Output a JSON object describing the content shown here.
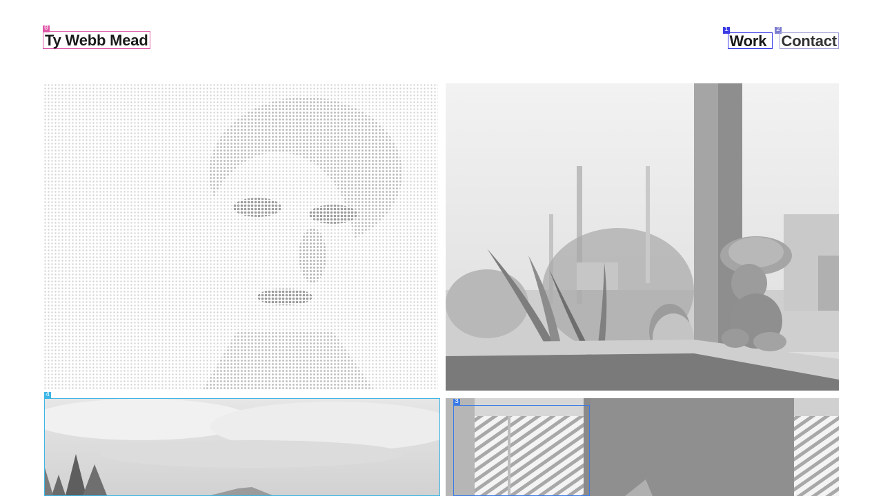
{
  "header": {
    "site_title": "Ty Webb Mead",
    "nav": [
      {
        "label": "Work"
      },
      {
        "label": "Contact"
      }
    ]
  },
  "annotations": {
    "title_index": "0",
    "work_index": "1",
    "contact_index": "2",
    "inner_index": "3",
    "tile_index": "4"
  },
  "colors": {
    "title_box": "#e056a7",
    "work_box": "#3a3ae6",
    "contact_box": "#a2a2d8",
    "tile_box": "#3cb6e6",
    "inner_box": "#3a7ae6"
  },
  "gallery": {
    "images": [
      {
        "name": "portrait-halftone"
      },
      {
        "name": "figurine-on-porch"
      },
      {
        "name": "mountain-landscape"
      },
      {
        "name": "window-blinds"
      }
    ]
  }
}
